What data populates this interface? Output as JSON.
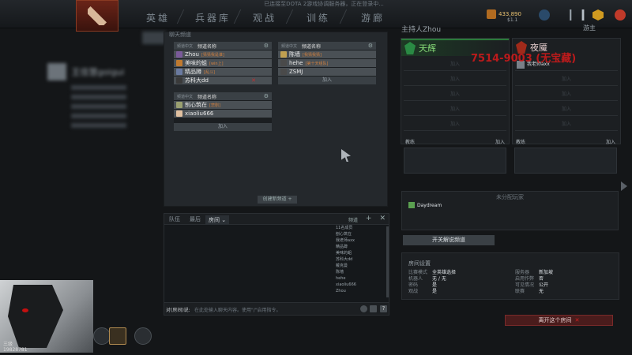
{
  "topbar": {
    "nav": [
      "英雄",
      "兵器库",
      "观战",
      "训练",
      "游廊"
    ],
    "status": "已连接至DOTA 2游戏协调服务器，正在登录中...",
    "gold": "433,890",
    "gold_sub": "$1.1",
    "colors": {
      "accent": "#d09a20",
      "danger": "#c03a2a"
    }
  },
  "profile": {
    "name": "王佳慧goigui"
  },
  "channels": {
    "header": "聊天频道",
    "list": [
      {
        "tag": "频道中文",
        "name": "频道名称",
        "members": [
          {
            "name": "Zhou",
            "sub": "[猜猜我是谁]"
          },
          {
            "name": "美味的蛆",
            "sub": "[win上]"
          },
          {
            "name": "精品蹲",
            "sub": "[乱斗]"
          },
          {
            "name": "苏科大dd",
            "sub": ""
          }
        ],
        "add": "加入"
      },
      {
        "tag": "频道中文",
        "name": "频道名称",
        "members": [
          {
            "name": "陈墙",
            "sub": "[我猜我猜]"
          },
          {
            "name": "hehe",
            "sub": "[第十天组队]"
          },
          {
            "name": "ZSMJ",
            "sub": ""
          }
        ],
        "add": "加入"
      },
      {
        "tag": "频道中文",
        "name": "频道名称",
        "members": [
          {
            "name": "刨心筑在",
            "sub": "[悲剧]"
          },
          {
            "name": "xiaoliu666",
            "sub": ""
          }
        ],
        "add": "加入"
      }
    ],
    "new_channel": "创建新频道 +"
  },
  "chat": {
    "tabs": [
      "队伍",
      "最后",
      "房间"
    ],
    "active_tab": "房间",
    "channel": "频道",
    "members_title": "11名成员",
    "members": [
      "刨心筑在",
      "我老师axx",
      "精品蹲",
      "美味的蛆",
      "苏科大dd",
      "戴克曼",
      "陈墙",
      "hehe",
      "xiaoliu666",
      "Zhou"
    ],
    "input_label": "对(房间)说:",
    "input_placeholder": "在此处输入聊天内容。使用\"/\"启用指令。"
  },
  "portrait": {
    "level": "三级",
    "sub": "19828781"
  },
  "lobby": {
    "title": "主持人Zhou",
    "right_label": "游主",
    "radiant": {
      "name": "天辉",
      "slots": [
        "加入",
        "加入",
        "加入",
        "加入",
        "加入"
      ]
    },
    "dire": {
      "name": "夜魇",
      "player": "我老师axx",
      "slots": [
        "加入",
        "加入",
        "加入",
        "加入"
      ]
    },
    "overlay": "7514-9003 (无宝藏)",
    "coach_label": "教练",
    "coach_join": "加入",
    "unassigned_title": "未分配玩家",
    "unassigned_player": "Daydream",
    "caster_button": "开关解说频道",
    "settings_title": "房间设置",
    "settings_left": [
      {
        "k": "比赛模式",
        "v": "全英雄选择"
      },
      {
        "k": "机器人",
        "v": "无 / 无"
      },
      {
        "k": "密码",
        "v": "是"
      },
      {
        "k": "观战",
        "v": "是"
      }
    ],
    "settings_right": [
      {
        "k": "服务器",
        "v": "新加坡"
      },
      {
        "k": "启用作弊",
        "v": "否"
      },
      {
        "k": "可见情况",
        "v": "公开"
      },
      {
        "k": "联赛",
        "v": "无"
      }
    ],
    "leave_button": "离开这个房间"
  }
}
